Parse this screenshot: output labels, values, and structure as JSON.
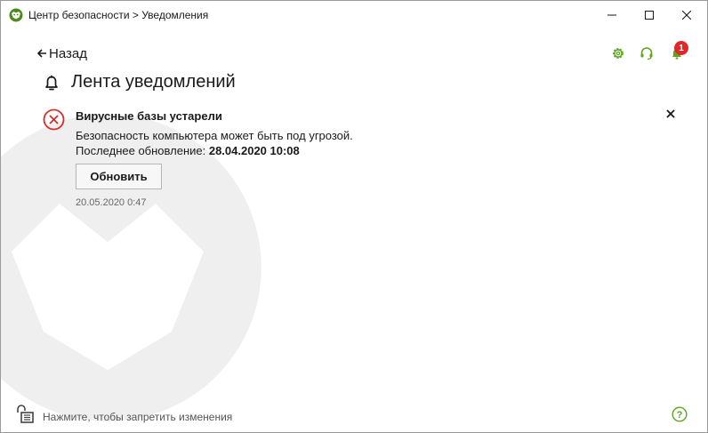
{
  "window": {
    "title": "Центр безопасности > Уведомления",
    "controls": {
      "minimize": "—",
      "maximize": "☐",
      "close": "✕"
    }
  },
  "nav": {
    "back_arrow": "🡐",
    "back_label": "Назад"
  },
  "toolbar": {
    "icons": [
      "settings-gear-icon",
      "support-headset-icon",
      "notification-bell-icon"
    ],
    "notification_count": "1",
    "accent_color": "#5ea51f",
    "badge_color": "#e3262a"
  },
  "page": {
    "title": "Лента уведомлений"
  },
  "notification": {
    "title": "Вирусные базы устарели",
    "message": "Безопасность компьютера может быть под угрозой.",
    "last_update_label": "Последнее обновление: ",
    "last_update_value": "28.04.2020 10:08",
    "action_label": "Обновить",
    "timestamp": "20.05.2020 0:47",
    "close_symbol": "✕",
    "status_color": "#d62e2e"
  },
  "footer": {
    "lock_text": "Нажмите, чтобы запретить изменения"
  }
}
